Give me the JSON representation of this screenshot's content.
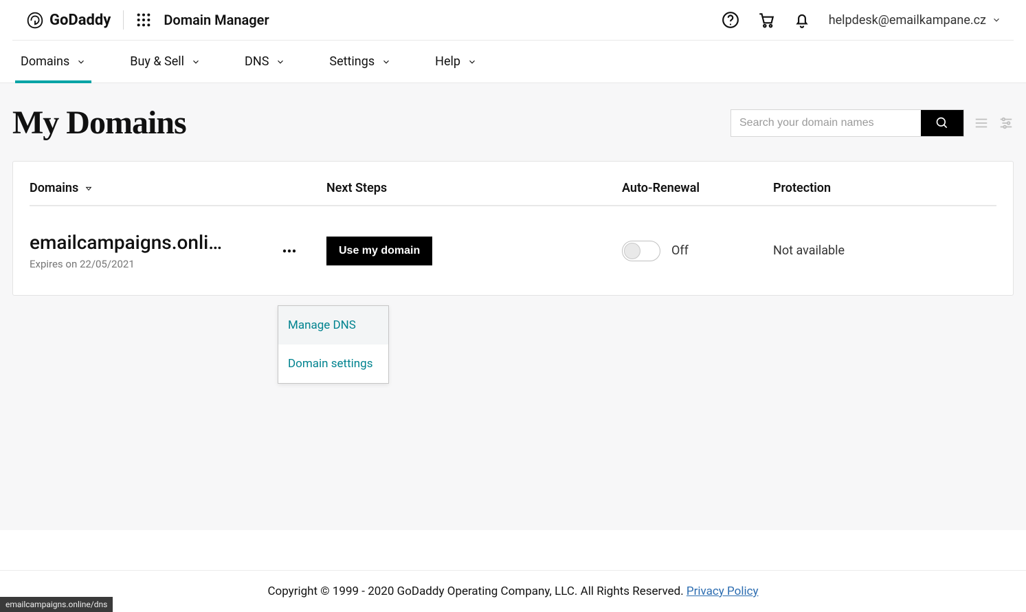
{
  "header": {
    "brand": "GoDaddy",
    "app_title": "Domain Manager",
    "account_email": "helpdesk@emailkampane.cz"
  },
  "nav": {
    "items": [
      {
        "label": "Domains",
        "active": true
      },
      {
        "label": "Buy & Sell",
        "active": false
      },
      {
        "label": "DNS",
        "active": false
      },
      {
        "label": "Settings",
        "active": false
      },
      {
        "label": "Help",
        "active": false
      }
    ]
  },
  "page": {
    "title": "My Domains",
    "search_placeholder": "Search your domain names"
  },
  "table": {
    "columns": {
      "domains": "Domains",
      "next_steps": "Next Steps",
      "auto_renewal": "Auto-Renewal",
      "protection": "Protection"
    },
    "rows": [
      {
        "domain": "emailcampaigns.onli…",
        "expires": "Expires on 22/05/2021",
        "next_step_button": "Use my domain",
        "auto_renewal_state": "Off",
        "protection": "Not available"
      }
    ]
  },
  "dropdown": {
    "items": [
      {
        "label": "Manage DNS",
        "hover": true
      },
      {
        "label": "Domain settings",
        "hover": false
      }
    ]
  },
  "footer": {
    "copyright": "Copyright © 1999 - 2020 GoDaddy Operating Company, LLC. All Rights Reserved. ",
    "privacy_label": "Privacy Policy"
  },
  "status_bar": "emailcampaigns.online/dns"
}
